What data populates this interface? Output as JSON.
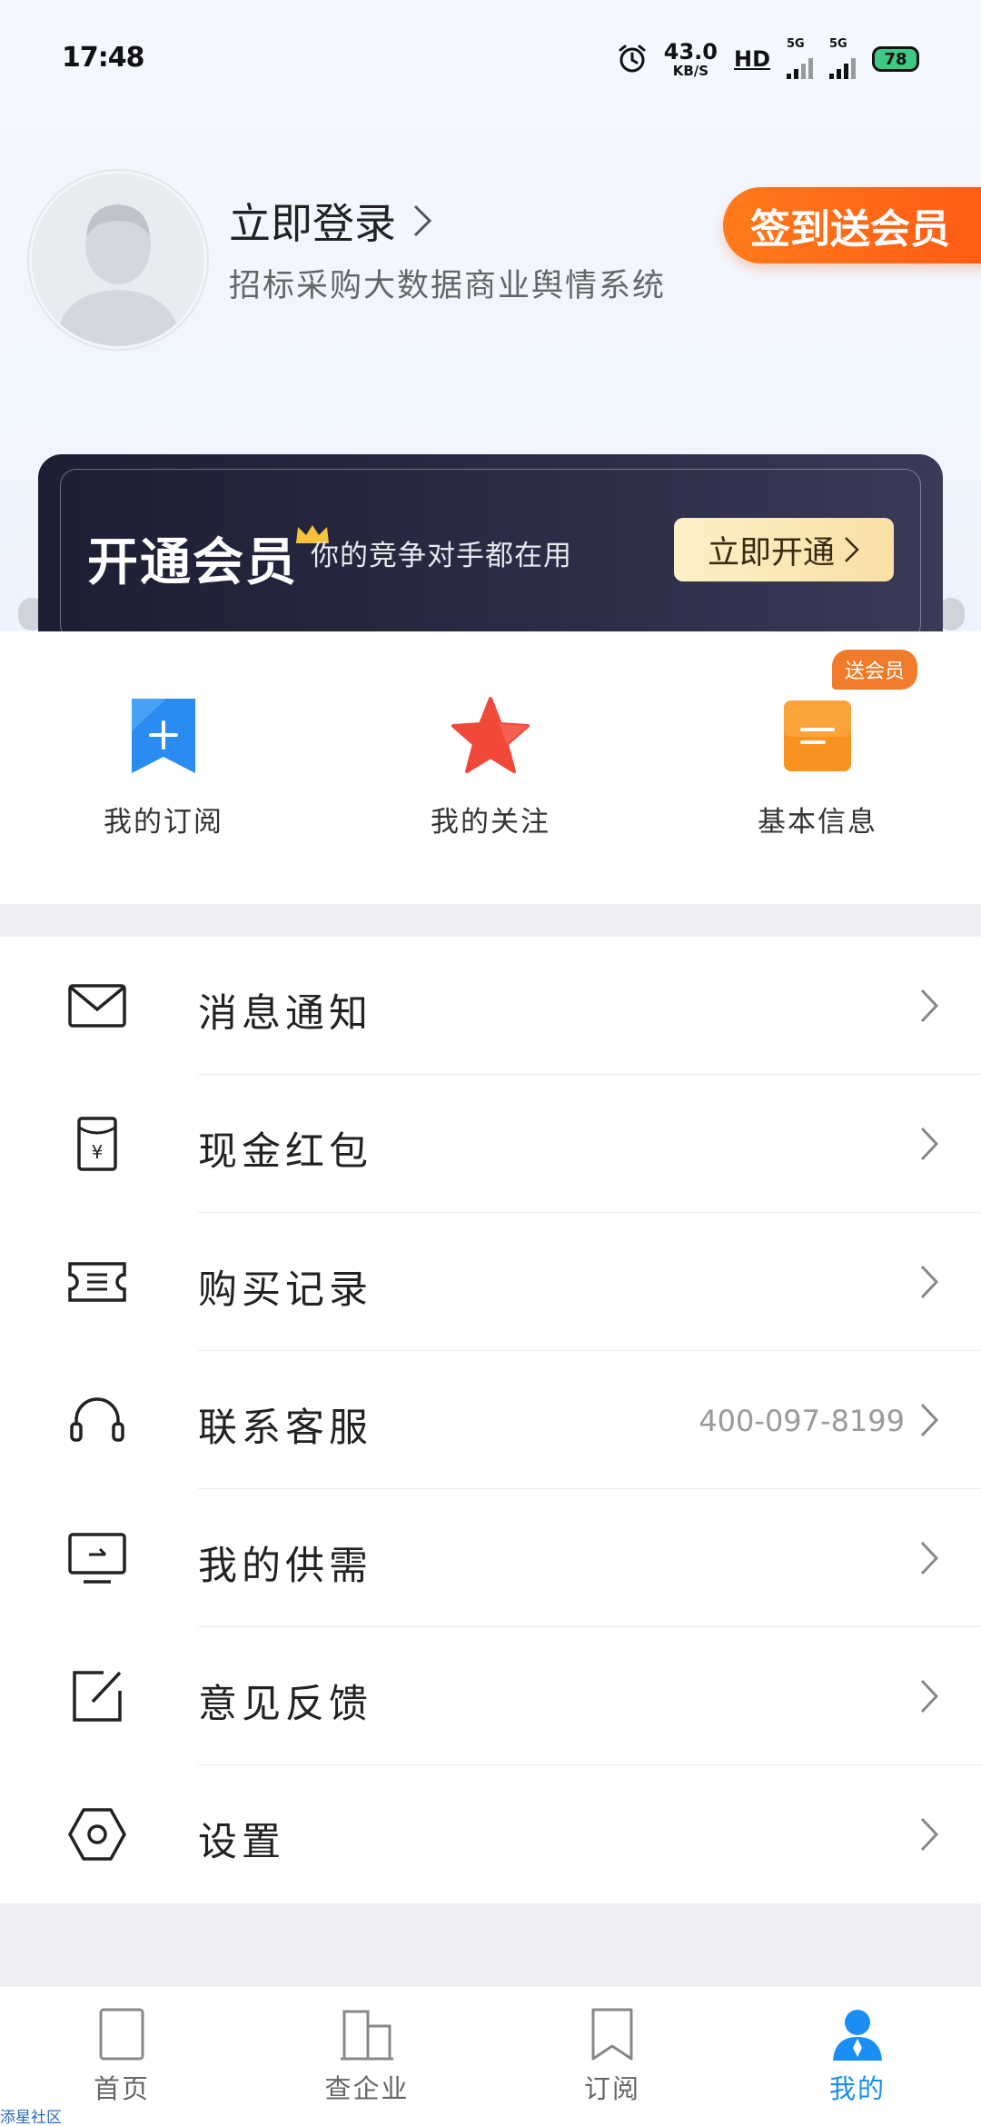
{
  "status_bar": {
    "time": "17:48",
    "net_speed": "43.0",
    "net_unit": "KB/S",
    "hd": "HD",
    "sim1": "5G",
    "sim2": "5G",
    "battery": "78"
  },
  "profile": {
    "login_label": "立即登录",
    "subtitle": "招标采购大数据商业舆情系统",
    "signin_badge": "签到送会员"
  },
  "vip_banner": {
    "title": "开通会员",
    "subtitle": "你的竞争对手都在用",
    "button_label": "立即开通"
  },
  "quick_actions": [
    {
      "label": "我的订阅",
      "icon": "subscription-icon",
      "color": "#2a8cf0"
    },
    {
      "label": "我的关注",
      "icon": "star-icon",
      "color": "#f0493a"
    },
    {
      "label": "基本信息",
      "icon": "info-icon",
      "color": "#f7931e",
      "tag": "送会员"
    }
  ],
  "menu": [
    {
      "label": "消息通知",
      "icon": "mail-icon"
    },
    {
      "label": "现金红包",
      "icon": "red-envelope-icon"
    },
    {
      "label": "购买记录",
      "icon": "ticket-icon"
    },
    {
      "label": "联系客服",
      "icon": "headset-icon",
      "value": "400-097-8199"
    },
    {
      "label": "我的供需",
      "icon": "monitor-icon"
    },
    {
      "label": "意见反馈",
      "icon": "edit-icon"
    },
    {
      "label": "设置",
      "icon": "settings-hexagon-icon"
    }
  ],
  "bottom_nav": [
    {
      "label": "首页",
      "icon": "home-icon"
    },
    {
      "label": "查企业",
      "icon": "company-icon"
    },
    {
      "label": "订阅",
      "icon": "bookmark-icon"
    },
    {
      "label": "我的",
      "icon": "profile-icon",
      "active": true
    }
  ],
  "watermark": "添星社区",
  "colors": {
    "accent_blue": "#1a8ef2",
    "orange": "#ff6a1a",
    "vip_dark": "#1d1e33",
    "vip_gold": "#f8e0a6"
  }
}
